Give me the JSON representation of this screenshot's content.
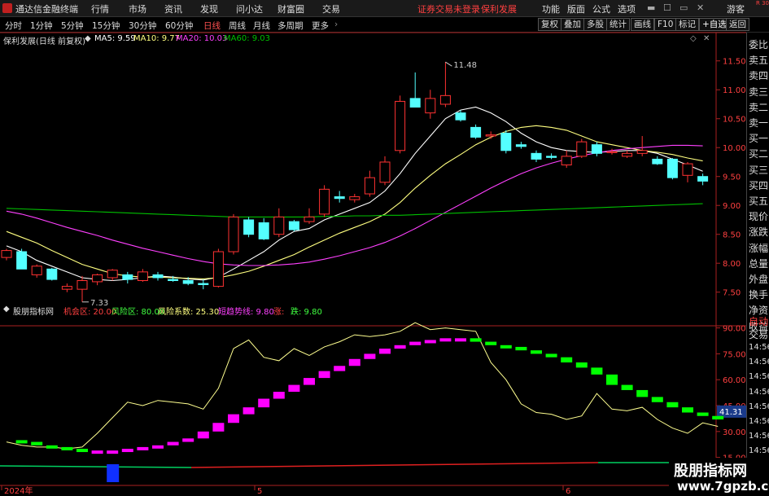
{
  "app": {
    "title": "通达信金融终端",
    "menu": [
      "行情",
      "市场",
      "资讯",
      "发现",
      "问小达",
      "财富圈",
      "交易"
    ],
    "alert": "证券交易未登录",
    "stock_title": "保利发展",
    "menu_right": [
      "功能",
      "版面",
      "公式",
      "选项"
    ],
    "guest": "游客",
    "tag": "R 300"
  },
  "toolbar": {
    "periods": [
      "分时",
      "1分钟",
      "5分钟",
      "15分钟",
      "30分钟",
      "60分钟",
      "日线",
      "周线",
      "月线",
      "多周期",
      "更多"
    ],
    "active": "日线",
    "right_buttons": [
      "复权",
      "叠加",
      "多股",
      "统计",
      "画线",
      "F10",
      "标记",
      "+自选",
      "返回"
    ]
  },
  "main_info": {
    "name": "保利发展(日线 前复权)",
    "ma5": "MA5: 9.59",
    "ma10": "MA10: 9.77",
    "ma20": "MA20: 10.03",
    "ma60": "MA60: 9.03"
  },
  "sub_info": {
    "name": "股朋指标网",
    "opp": "机会区: 20.00",
    "risk": "风险区: 80.00",
    "coef": "风险系数: 25.30",
    "line": "短趋势线: 9.80",
    "up": "涨:",
    "down": "跌: 9.80"
  },
  "side_panel": [
    "委比",
    "卖五",
    "卖四",
    "卖三",
    "卖二",
    "卖一",
    "买一",
    "买二",
    "买三",
    "买四",
    "买五",
    "现价",
    "涨跌",
    "涨幅",
    "总量",
    "外盘",
    "换手",
    "净资",
    "收益",
    "自动",
    "交易",
    "14:56",
    "14:56",
    "14:56",
    "14:56",
    "14:56",
    "14:56",
    "14:56",
    "14:56"
  ],
  "watermark": {
    "line1": "股朋指标网",
    "line2": "www.7gpzb.com"
  },
  "colors": {
    "up": "#ff3232",
    "down": "#54ffff",
    "ma5": "#ffffff",
    "ma10": "#ffff80",
    "ma20": "#ff40ff",
    "ma60": "#00c000",
    "risk_up": "#ff00ff",
    "risk_down": "#00ff00"
  },
  "chart_data": [
    {
      "type": "candlestick",
      "title": "保利发展(日线 前复权)",
      "y_ticks": [
        "11.50",
        "11.00",
        "10.50",
        "10.00",
        "9.50",
        "9.00",
        "8.50",
        "8.00",
        "7.50"
      ],
      "ylim": [
        7.2,
        11.75
      ],
      "annotations": [
        {
          "label": "11.48",
          "value": 11.48,
          "index": 29
        },
        {
          "label": "7.33",
          "value": 7.33,
          "index": 5
        }
      ],
      "candles": [
        {
          "o": 8.1,
          "h": 8.25,
          "l": 8.05,
          "c": 8.22
        },
        {
          "o": 8.2,
          "h": 8.25,
          "l": 7.9,
          "c": 7.9
        },
        {
          "o": 7.8,
          "h": 7.98,
          "l": 7.75,
          "c": 7.95
        },
        {
          "o": 7.9,
          "h": 7.92,
          "l": 7.7,
          "c": 7.72
        },
        {
          "o": 7.55,
          "h": 7.65,
          "l": 7.5,
          "c": 7.6
        },
        {
          "o": 7.55,
          "h": 7.78,
          "l": 7.33,
          "c": 7.7
        },
        {
          "o": 7.68,
          "h": 7.82,
          "l": 7.62,
          "c": 7.8
        },
        {
          "o": 7.75,
          "h": 7.9,
          "l": 7.7,
          "c": 7.88
        },
        {
          "o": 7.8,
          "h": 7.85,
          "l": 7.65,
          "c": 7.72
        },
        {
          "o": 7.7,
          "h": 7.9,
          "l": 7.68,
          "c": 7.85
        },
        {
          "o": 7.8,
          "h": 7.85,
          "l": 7.7,
          "c": 7.75
        },
        {
          "o": 7.72,
          "h": 7.78,
          "l": 7.68,
          "c": 7.7
        },
        {
          "o": 7.7,
          "h": 7.76,
          "l": 7.62,
          "c": 7.65
        },
        {
          "o": 7.65,
          "h": 7.72,
          "l": 7.55,
          "c": 7.63
        },
        {
          "o": 7.6,
          "h": 8.25,
          "l": 7.58,
          "c": 8.2
        },
        {
          "o": 8.2,
          "h": 8.85,
          "l": 8.15,
          "c": 8.8
        },
        {
          "o": 8.75,
          "h": 8.8,
          "l": 8.45,
          "c": 8.5
        },
        {
          "o": 8.7,
          "h": 8.78,
          "l": 8.4,
          "c": 8.42
        },
        {
          "o": 8.5,
          "h": 8.95,
          "l": 8.45,
          "c": 8.8
        },
        {
          "o": 8.72,
          "h": 8.75,
          "l": 8.55,
          "c": 8.58
        },
        {
          "o": 8.72,
          "h": 8.95,
          "l": 8.68,
          "c": 8.8
        },
        {
          "o": 8.85,
          "h": 9.35,
          "l": 8.8,
          "c": 9.28
        },
        {
          "o": 9.15,
          "h": 9.25,
          "l": 9.05,
          "c": 9.12
        },
        {
          "o": 9.1,
          "h": 9.2,
          "l": 9.05,
          "c": 9.15
        },
        {
          "o": 9.2,
          "h": 9.6,
          "l": 9.15,
          "c": 9.48
        },
        {
          "o": 9.4,
          "h": 9.85,
          "l": 9.35,
          "c": 9.75
        },
        {
          "o": 9.95,
          "h": 10.9,
          "l": 9.9,
          "c": 10.8
        },
        {
          "o": 10.85,
          "h": 11.3,
          "l": 10.75,
          "c": 10.7
        },
        {
          "o": 10.6,
          "h": 11.0,
          "l": 10.5,
          "c": 10.85
        },
        {
          "o": 10.75,
          "h": 11.48,
          "l": 10.7,
          "c": 10.9
        },
        {
          "o": 10.6,
          "h": 10.65,
          "l": 10.45,
          "c": 10.48
        },
        {
          "o": 10.35,
          "h": 10.4,
          "l": 10.15,
          "c": 10.18
        },
        {
          "o": 10.2,
          "h": 10.28,
          "l": 10.15,
          "c": 10.22
        },
        {
          "o": 10.25,
          "h": 10.3,
          "l": 9.9,
          "c": 9.95
        },
        {
          "o": 10.05,
          "h": 10.1,
          "l": 9.98,
          "c": 10.02
        },
        {
          "o": 9.9,
          "h": 9.95,
          "l": 9.75,
          "c": 9.8
        },
        {
          "o": 9.85,
          "h": 9.9,
          "l": 9.8,
          "c": 9.83
        },
        {
          "o": 9.7,
          "h": 9.95,
          "l": 9.65,
          "c": 9.85
        },
        {
          "o": 9.85,
          "h": 10.15,
          "l": 9.82,
          "c": 10.1
        },
        {
          "o": 10.05,
          "h": 10.1,
          "l": 9.85,
          "c": 9.9
        },
        {
          "o": 9.92,
          "h": 9.98,
          "l": 9.88,
          "c": 9.93
        },
        {
          "o": 9.85,
          "h": 9.95,
          "l": 9.82,
          "c": 9.9
        },
        {
          "o": 9.9,
          "h": 10.2,
          "l": 9.85,
          "c": 9.95
        },
        {
          "o": 9.8,
          "h": 9.85,
          "l": 9.7,
          "c": 9.72
        },
        {
          "o": 9.8,
          "h": 9.82,
          "l": 9.45,
          "c": 9.48
        },
        {
          "o": 9.52,
          "h": 9.75,
          "l": 9.4,
          "c": 9.72
        },
        {
          "o": 9.5,
          "h": 9.55,
          "l": 9.35,
          "c": 9.42
        }
      ],
      "series": [
        {
          "name": "MA5",
          "values": [
            8.3,
            8.2,
            8.05,
            7.95,
            7.85,
            7.75,
            7.72,
            7.7,
            7.72,
            7.75,
            7.78,
            7.76,
            7.73,
            7.71,
            7.76,
            7.9,
            8.05,
            8.2,
            8.4,
            8.55,
            8.6,
            8.75,
            8.85,
            8.95,
            9.05,
            9.25,
            9.55,
            9.9,
            10.2,
            10.5,
            10.65,
            10.7,
            10.6,
            10.45,
            10.25,
            10.1,
            10.0,
            9.95,
            9.93,
            9.92,
            9.93,
            9.95,
            9.95,
            9.9,
            9.8,
            9.7,
            9.59
          ]
        },
        {
          "name": "MA10",
          "values": [
            8.55,
            8.45,
            8.35,
            8.22,
            8.1,
            7.98,
            7.9,
            7.82,
            7.78,
            7.76,
            7.76,
            7.75,
            7.74,
            7.73,
            7.75,
            7.8,
            7.86,
            7.95,
            8.05,
            8.15,
            8.28,
            8.4,
            8.52,
            8.62,
            8.72,
            8.85,
            9.05,
            9.3,
            9.52,
            9.72,
            9.88,
            10.05,
            10.18,
            10.28,
            10.35,
            10.38,
            10.35,
            10.3,
            10.2,
            10.1,
            10.05,
            10.0,
            9.95,
            9.92,
            9.88,
            9.82,
            9.77
          ]
        },
        {
          "name": "MA20",
          "values": [
            8.9,
            8.85,
            8.78,
            8.7,
            8.62,
            8.55,
            8.48,
            8.4,
            8.33,
            8.26,
            8.2,
            8.14,
            8.08,
            8.03,
            7.99,
            7.97,
            7.96,
            7.96,
            7.97,
            7.99,
            8.02,
            8.07,
            8.13,
            8.2,
            8.27,
            8.36,
            8.47,
            8.6,
            8.74,
            8.88,
            9.02,
            9.16,
            9.3,
            9.43,
            9.55,
            9.65,
            9.73,
            9.8,
            9.86,
            9.91,
            9.95,
            9.98,
            10.0,
            10.02,
            10.04,
            10.04,
            10.03
          ]
        },
        {
          "name": "MA60",
          "values": [
            8.95,
            8.94,
            8.93,
            8.92,
            8.91,
            8.9,
            8.89,
            8.88,
            8.87,
            8.86,
            8.85,
            8.84,
            8.83,
            8.82,
            8.81,
            8.8,
            8.8,
            8.8,
            8.8,
            8.8,
            8.8,
            8.81,
            8.81,
            8.82,
            8.82,
            8.83,
            8.83,
            8.84,
            8.85,
            8.86,
            8.87,
            8.88,
            8.89,
            8.9,
            8.91,
            8.92,
            8.93,
            8.94,
            8.95,
            8.96,
            8.97,
            8.98,
            8.99,
            9.0,
            9.01,
            9.02,
            9.03
          ]
        }
      ]
    },
    {
      "type": "line",
      "title": "股朋指标网",
      "y_ticks": [
        "90.00",
        "75.00",
        "60.00",
        "45.00",
        "30.00",
        "15.00"
      ],
      "ylim": [
        12,
        95
      ],
      "current_label": "41.31",
      "x_labels": [
        "2024年",
        "5",
        "6"
      ],
      "series": [
        {
          "name": "风险系数",
          "values": [
            24,
            22,
            21,
            21,
            20,
            21,
            29,
            38,
            47,
            45,
            48,
            47,
            46,
            43,
            55,
            78,
            83,
            73,
            71,
            78,
            74,
            79,
            82,
            86,
            85,
            86,
            88,
            93,
            89,
            90,
            89,
            88,
            70,
            60,
            46,
            41,
            40,
            37,
            39,
            52,
            43,
            42,
            44,
            37,
            32,
            29,
            35,
            33
          ]
        },
        {
          "name": "短趋势线",
          "values": [
            25,
            24,
            22,
            21,
            20,
            19,
            19,
            19,
            20,
            21,
            22,
            24,
            26,
            30,
            35,
            40,
            44,
            49,
            53,
            57,
            61,
            65,
            68,
            72,
            75,
            78,
            80,
            82,
            83,
            84,
            84,
            82,
            80,
            79,
            77,
            75,
            73,
            70,
            67,
            63,
            57,
            54,
            50,
            47,
            44,
            41,
            39,
            37
          ]
        }
      ],
      "histogram": {
        "name": "信号",
        "index": 7
      }
    }
  ]
}
